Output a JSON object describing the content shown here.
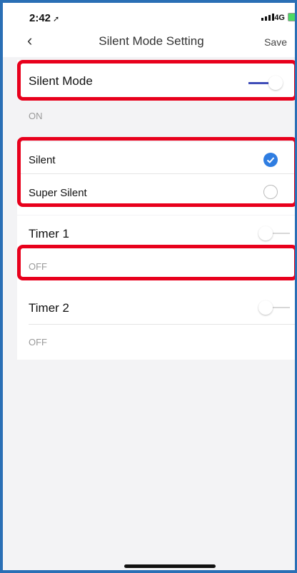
{
  "status_bar": {
    "time": "2:42",
    "location_glyph": "➚",
    "network": "4G"
  },
  "nav": {
    "back": "‹",
    "title": "Silent Mode Setting",
    "save_label": "Save"
  },
  "silent_mode": {
    "label": "Silent Mode",
    "enabled": true,
    "status": "ON"
  },
  "modes": [
    {
      "label": "Silent",
      "selected": true
    },
    {
      "label": "Super Silent",
      "selected": false
    }
  ],
  "timer1": {
    "label": "Timer 1",
    "enabled": false,
    "status": "OFF"
  },
  "timer2": {
    "label": "Timer 2",
    "enabled": false,
    "status": "OFF"
  },
  "colors": {
    "toggle_on": "#3f4db8",
    "check": "#2f7de1",
    "highlight": "#e8001c",
    "frame": "#2a6fb5"
  }
}
